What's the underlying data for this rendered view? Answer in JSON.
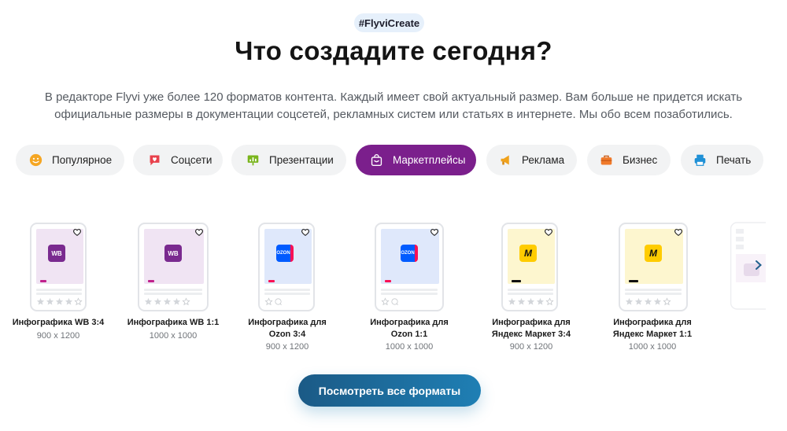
{
  "tag": "#FlyviCreate",
  "title": "Что создадите сегодня?",
  "description": [
    "В редакторе Flyvi уже более 120 форматов контента. Каждый имеет свой актуальный размер. Вам больше не придется искать",
    "официальные размеры в документации соцсетей, рекламных систем или статьях в интернете. Мы обо всем позаботились."
  ],
  "categories": [
    {
      "label": "Популярное",
      "icon": "smile-icon"
    },
    {
      "label": "Соцсети",
      "icon": "heart-bubble-icon"
    },
    {
      "label": "Презентации",
      "icon": "presentation-icon"
    },
    {
      "label": "Маркетплейсы",
      "icon": "shopping-bag-icon",
      "active": true
    },
    {
      "label": "Реклама",
      "icon": "megaphone-icon"
    },
    {
      "label": "Бизнес",
      "icon": "briefcase-icon"
    },
    {
      "label": "Печать",
      "icon": "printer-icon"
    }
  ],
  "formats": [
    {
      "name_line1": "Инфографика WB 3:4",
      "name_line2": "",
      "size": "900 x 1200",
      "logo": "WB",
      "brand": "wildberries"
    },
    {
      "name_line1": "Инфографика WB 1:1",
      "name_line2": "",
      "size": "1000 x 1000",
      "logo": "WB",
      "brand": "wildberries"
    },
    {
      "name_line1": "Инфографика для",
      "name_line2": "Ozon 3:4",
      "size": "900 x 1200",
      "logo": "OZON",
      "brand": "ozon"
    },
    {
      "name_line1": "Инфографика для",
      "name_line2": "Ozon 1:1",
      "size": "1000 x 1000",
      "logo": "OZON",
      "brand": "ozon"
    },
    {
      "name_line1": "Инфографика для",
      "name_line2": "Яндекс Маркет 3:4",
      "size": "900 x 1200",
      "logo": "M",
      "brand": "yandex-market"
    },
    {
      "name_line1": "Инфографика для",
      "name_line2": "Яндекс Маркет 1:1",
      "size": "1000 x 1000",
      "logo": "M",
      "brand": "yandex-market"
    }
  ],
  "colors": {
    "active_chip": "#7b1f8c",
    "wb": "#7a2a8f",
    "ozon": "#005bff",
    "yandex_market": "#ffcc00",
    "cta": "#1f7fb4"
  },
  "cta_label": "Посмотреть все форматы"
}
